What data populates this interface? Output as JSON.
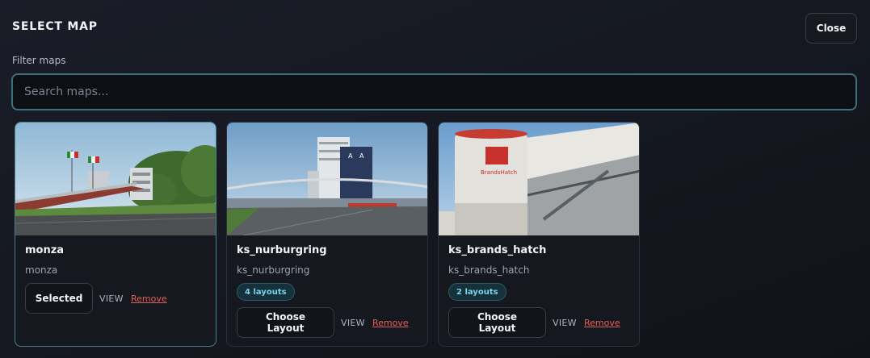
{
  "header": {
    "title": "SELECT MAP",
    "close_label": "Close"
  },
  "filter": {
    "label": "Filter maps",
    "placeholder": "Search maps...",
    "value": ""
  },
  "cards": [
    {
      "name": "monza",
      "subtitle": "monza",
      "badge": "",
      "primary_label": "Selected",
      "view_label": "VIEW",
      "remove_label": "Remove",
      "selected": true
    },
    {
      "name": "ks_nurburgring",
      "subtitle": "ks_nurburgring",
      "badge": "4 layouts",
      "primary_label": "Choose Layout",
      "view_label": "VIEW",
      "remove_label": "Remove",
      "selected": false
    },
    {
      "name": "ks_brands_hatch",
      "subtitle": "ks_brands_hatch",
      "badge": "2 layouts",
      "primary_label": "Choose Layout",
      "view_label": "VIEW",
      "remove_label": "Remove",
      "selected": false
    }
  ],
  "colors": {
    "accent": "#3e6f7c",
    "badge_text": "#7fd0ea",
    "remove": "#e0605a",
    "background": "#14171f"
  }
}
